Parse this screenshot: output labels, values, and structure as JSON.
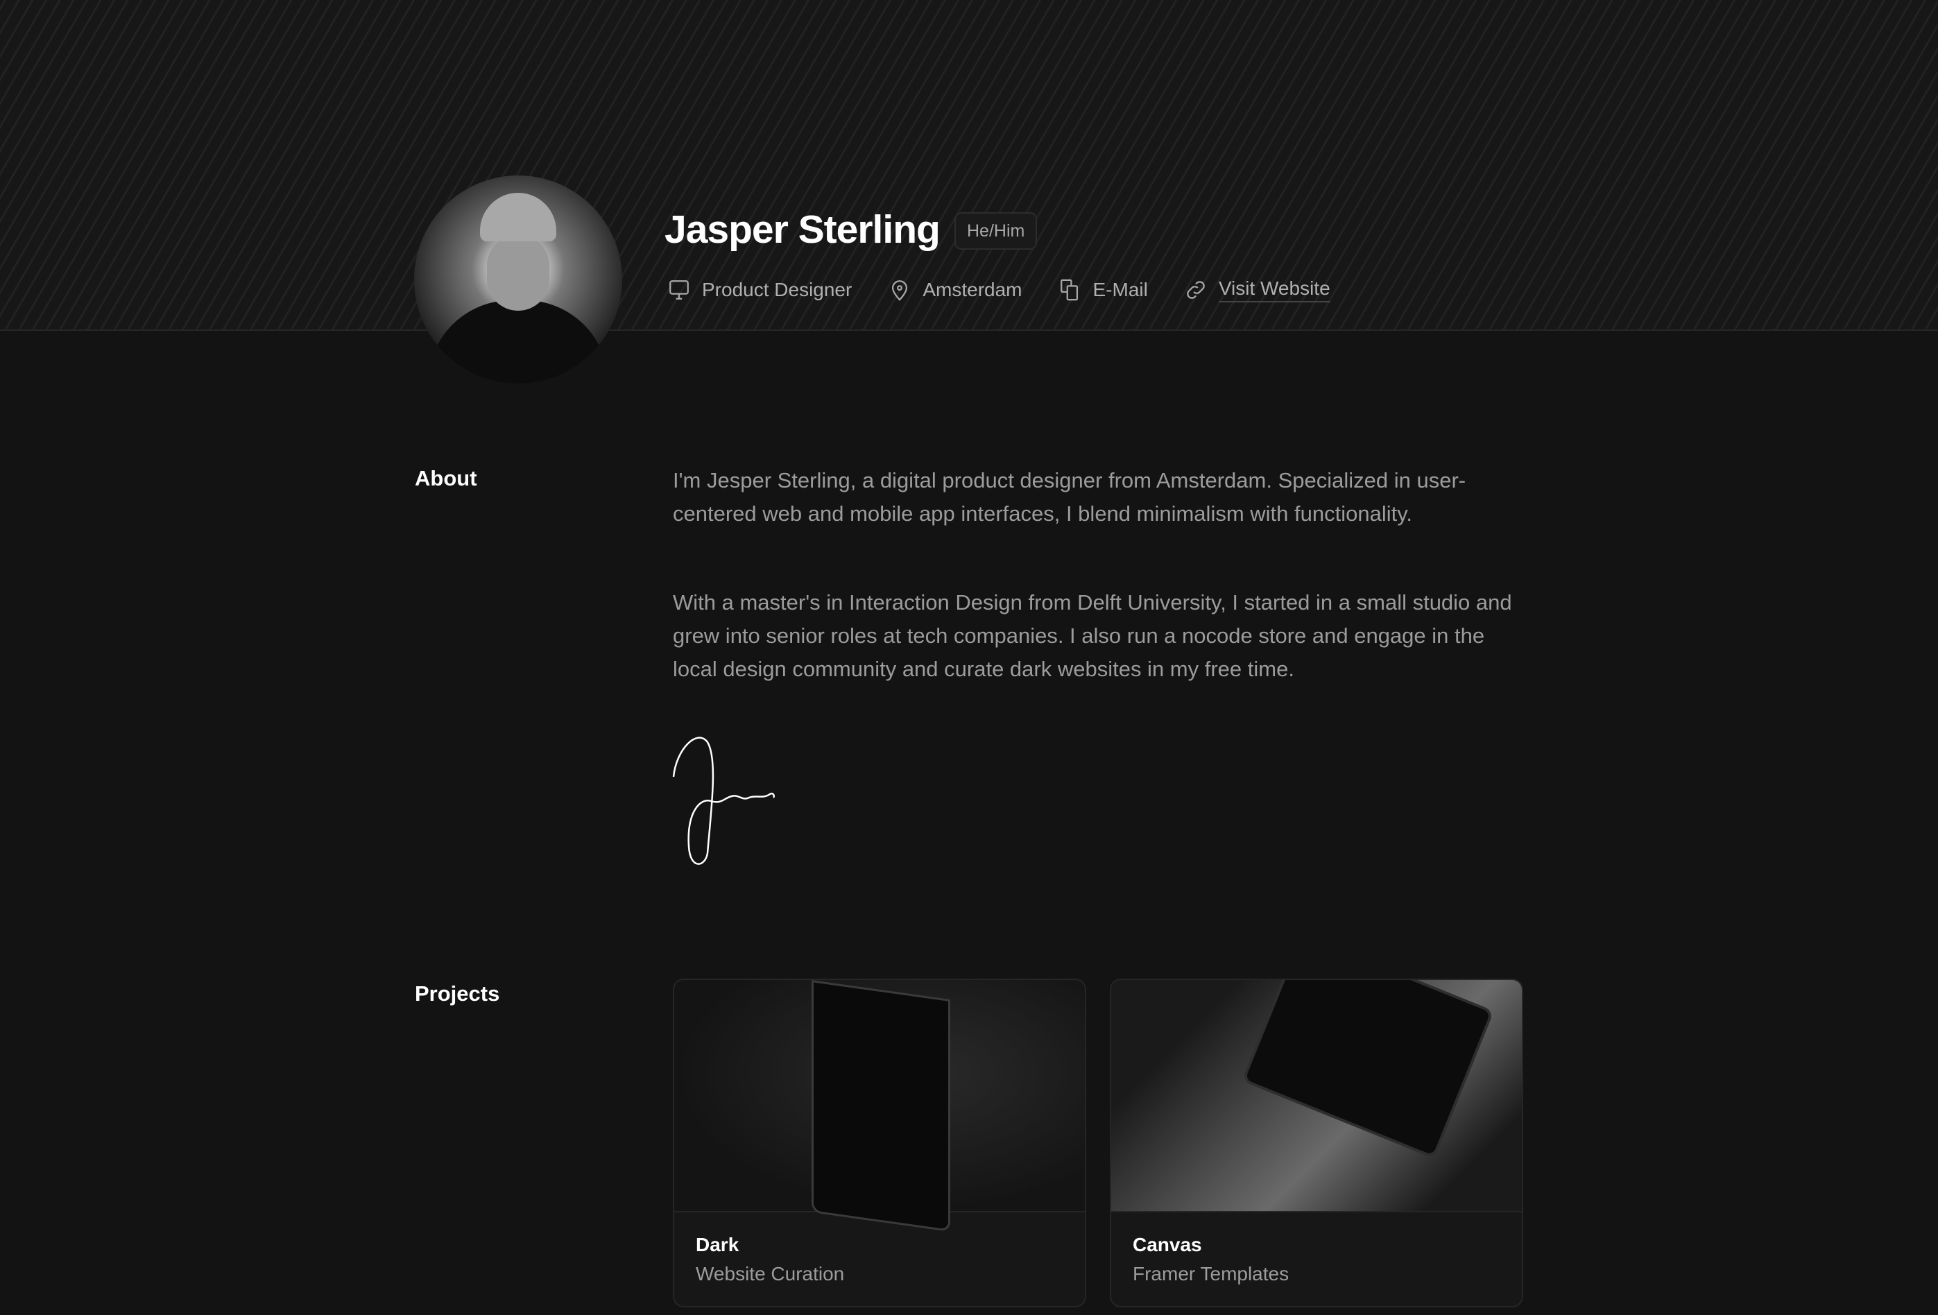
{
  "profile": {
    "name": "Jasper Sterling",
    "pronouns": "He/Him",
    "meta": [
      {
        "icon": "monitor-icon",
        "label": "Product Designer"
      },
      {
        "icon": "map-pin-icon",
        "label": "Amsterdam"
      },
      {
        "icon": "copy-icon",
        "label": "E-Mail"
      },
      {
        "icon": "link-icon",
        "label": "Visit Website"
      }
    ]
  },
  "about": {
    "label": "About",
    "paragraphs": [
      "I'm Jesper Sterling, a digital product designer from Amsterdam. Specialized in user-centered web and mobile app interfaces, I blend minimalism with functionality.",
      "With a master's in Interaction Design from Delft University, I started in a small studio and grew into senior roles at tech companies. I also run a nocode store and engage in the local design community and curate dark websites in my free time."
    ]
  },
  "projects": {
    "label": "Projects",
    "items": [
      {
        "title": "Dark",
        "subtitle": "Website Curation"
      },
      {
        "title": "Canvas",
        "subtitle": "Framer Templates"
      }
    ]
  }
}
